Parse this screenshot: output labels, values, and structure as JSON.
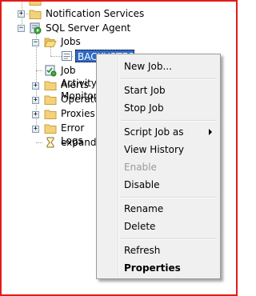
{
  "tree": {
    "notification_services": "Notification Services",
    "sql_server_agent": "SQL Server Agent",
    "jobs": "Jobs",
    "backup_job": "BACKUPTEST",
    "job_activity": "Job Activity Monitor",
    "alerts": "Alerts",
    "operators": "Operators",
    "proxies": "Proxies",
    "error_logs": "Error Logs",
    "expanding": "expanding"
  },
  "context_menu": {
    "new_job": "New Job...",
    "start_job": "Start Job",
    "stop_job": "Stop Job",
    "script_job_as": "Script Job as",
    "view_history": "View History",
    "enable": "Enable",
    "disable": "Disable",
    "rename": "Rename",
    "delete": "Delete",
    "refresh": "Refresh",
    "properties": "Properties"
  }
}
